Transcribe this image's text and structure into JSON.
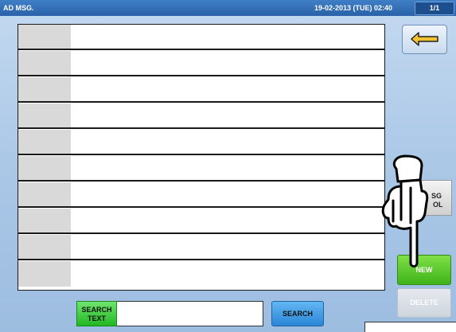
{
  "titlebar": {
    "title": "AD MSG.",
    "datetime": "19-02-2013 (TUE) 02:40",
    "page": "1/1"
  },
  "list": {
    "rows": [
      {
        "code": "",
        "text": ""
      },
      {
        "code": "",
        "text": ""
      },
      {
        "code": "",
        "text": ""
      },
      {
        "code": "",
        "text": ""
      },
      {
        "code": "",
        "text": ""
      },
      {
        "code": "",
        "text": ""
      },
      {
        "code": "",
        "text": ""
      },
      {
        "code": "",
        "text": ""
      },
      {
        "code": "",
        "text": ""
      },
      {
        "code": "",
        "text": ""
      }
    ]
  },
  "side": {
    "back_icon": "return-arrow-icon",
    "partial_line1": "SG",
    "partial_line2": "OL",
    "new_label": "NEW",
    "delete_label": "DELETE"
  },
  "search": {
    "label_line1": "SEARCH",
    "label_line2": "TEXT",
    "value": "",
    "button_label": "SEARCH"
  },
  "overlay": {
    "icon": "pointing-hand-icon"
  },
  "colors": {
    "titlebar": "#2a62a8",
    "background": "#a9c6e6",
    "new_button": "#3fb21a",
    "search_button": "#2a86d6",
    "search_label": "#22b822"
  }
}
